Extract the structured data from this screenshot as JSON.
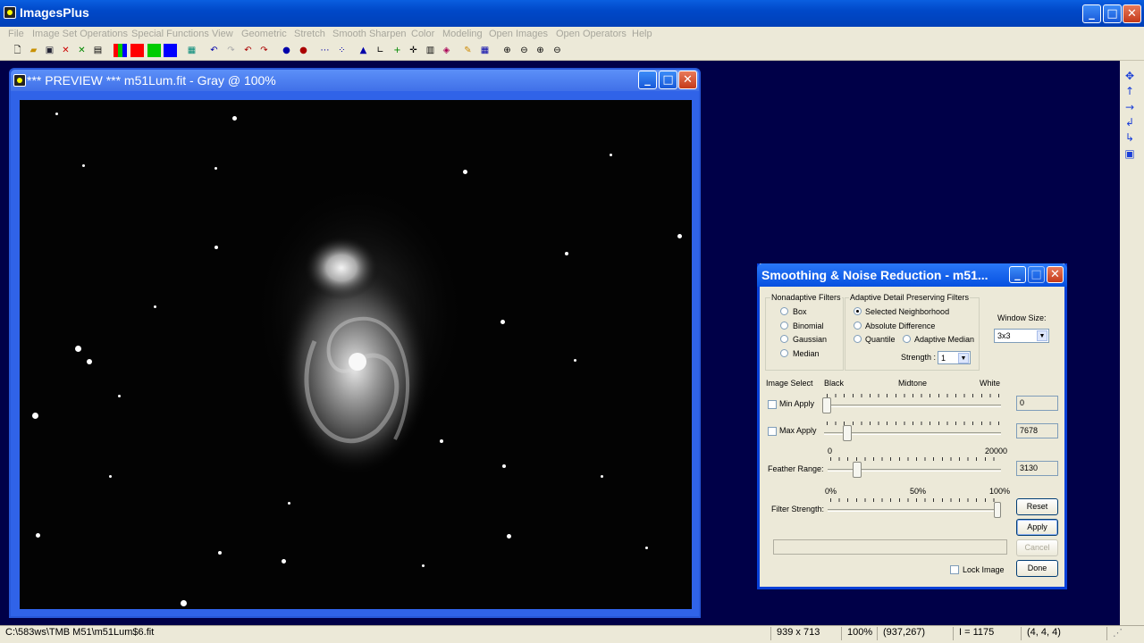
{
  "app": {
    "title": "ImagesPlus"
  },
  "menu": [
    "File",
    "Image Set Operations",
    "Special Functions",
    "View",
    "Geometric",
    "Stretch",
    "Smooth Sharpen",
    "Color",
    "Modeling",
    "Open Images",
    "Open Operators",
    "Help"
  ],
  "preview": {
    "title": "*** PREVIEW *** m51Lum.fit - Gray @ 100%"
  },
  "dialog": {
    "title": "Smoothing & Noise Reduction - m51...",
    "nonadaptive_label": "Nonadaptive Filters",
    "nonadaptive": [
      "Box",
      "Binomial",
      "Gaussian",
      "Median"
    ],
    "adaptive_label": "Adaptive Detail Preserving Filters",
    "adaptive": [
      "Selected Neighborhood",
      "Absolute Difference",
      "Quantile",
      "Adaptive Median"
    ],
    "selected_filter": "Selected Neighborhood",
    "strength_label": "Strength :",
    "strength_value": "1",
    "window_size_label": "Window Size:",
    "window_size_value": "3x3",
    "image_select_label": "Image Select",
    "black_label": "Black",
    "midtone_label": "Midtone",
    "white_label": "White",
    "min_apply_label": "Min Apply",
    "min_apply_checked": false,
    "min_value": "0",
    "max_apply_label": "Max Apply",
    "max_apply_checked": false,
    "max_value": "7678",
    "range_min": "0",
    "range_max": "20000",
    "feather_label": "Feather Range:",
    "feather_value": "3130",
    "pct_0": "0%",
    "pct_50": "50%",
    "pct_100": "100%",
    "strength_slider_label": "Filter Strength:",
    "filter_strength_percent": 100,
    "reset": "Reset",
    "apply": "Apply",
    "cancel": "Cancel",
    "done": "Done",
    "lock_label": "Lock Image",
    "lock_checked": false
  },
  "status": {
    "path": "C:\\583ws\\TMB M51\\m51Lum$6.fit",
    "dims": "939 x 713",
    "zoom": "100%",
    "coords": "(937,267)",
    "intensity": "I = 1175",
    "rgb": "(4, 4, 4)"
  },
  "colors": {
    "workspace": "#000048",
    "titlebar": "#0048c8"
  }
}
